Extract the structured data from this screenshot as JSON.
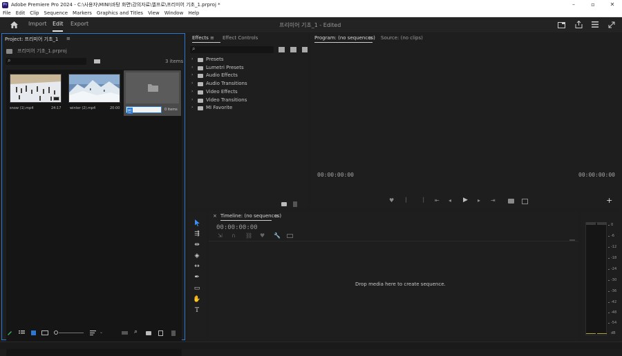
{
  "titlebar": {
    "app_icon": "Pr",
    "title": "Adobe Premiere Pro 2024 - C:\\사용자\\MINI\\바탕 화면\\강의자료\\엘프로\\프리미어 기초_1.prproj *",
    "minimize": "–",
    "maximize": "▫",
    "close": "✕"
  },
  "menubar": [
    "File",
    "Edit",
    "Clip",
    "Sequence",
    "Markers",
    "Graphics and Titles",
    "View",
    "Window",
    "Help"
  ],
  "header": {
    "home_icon": "home-icon",
    "tabs": [
      "Import",
      "Edit",
      "Export"
    ],
    "active_tab": "Edit",
    "document_title": "프리미어 기초_1",
    "document_status": "- Edited"
  },
  "project_panel": {
    "tab_label": "Project: 프리미어 기초_1",
    "file_name": "프리미어 기초_1.prproj",
    "item_count": "3 items",
    "items": [
      {
        "name": "snow (1).mp4",
        "duration": "24:17"
      },
      {
        "name": "winter (2).mp4",
        "duration": "20:00"
      },
      {
        "name": "빈",
        "duration": "0 items"
      }
    ]
  },
  "effects_panel": {
    "tabs": [
      "Effects",
      "Effect Controls"
    ],
    "tree": [
      "Presets",
      "Lumetri Presets",
      "Audio Effects",
      "Audio Transitions",
      "Video Effects",
      "Video Transitions",
      "MI Favorite"
    ]
  },
  "program_monitor": {
    "tabs": [
      "Program: (no sequences)",
      "Source: (no clips)"
    ],
    "timecode_left": "00:00:00:00",
    "timecode_right": "00:00:00:00",
    "add_button": "+"
  },
  "timeline": {
    "tab_label": "Timeline: (no sequences)",
    "close": "×",
    "timecode": "00:00:00:00",
    "empty_message": "Drop media here to create sequence."
  },
  "audio_meter": {
    "labels": [
      "0",
      "-6",
      "-12",
      "-18",
      "-24",
      "-30",
      "-36",
      "-42",
      "-48",
      "-54",
      "dB"
    ]
  },
  "tools": {
    "type_tool": "T"
  },
  "colors": {
    "accent": "#2b79d3",
    "panel_bg": "#1e1e1e",
    "header_bg": "#232323",
    "meter_green": "#b8a63a"
  }
}
